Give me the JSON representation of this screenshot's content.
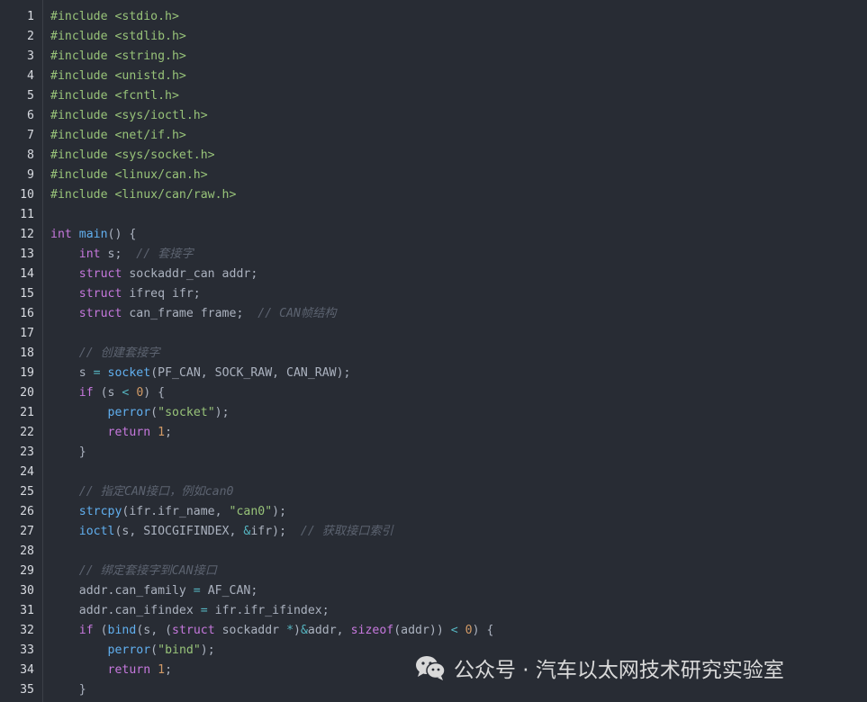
{
  "editor": {
    "lines": [
      {
        "n": "1",
        "tokens": [
          {
            "t": "#include ",
            "c": "pp"
          },
          {
            "t": "<stdio.h>",
            "c": "hdr"
          }
        ]
      },
      {
        "n": "2",
        "tokens": [
          {
            "t": "#include ",
            "c": "pp"
          },
          {
            "t": "<stdlib.h>",
            "c": "hdr"
          }
        ]
      },
      {
        "n": "3",
        "tokens": [
          {
            "t": "#include ",
            "c": "pp"
          },
          {
            "t": "<string.h>",
            "c": "hdr"
          }
        ]
      },
      {
        "n": "4",
        "tokens": [
          {
            "t": "#include ",
            "c": "pp"
          },
          {
            "t": "<unistd.h>",
            "c": "hdr"
          }
        ]
      },
      {
        "n": "5",
        "tokens": [
          {
            "t": "#include ",
            "c": "pp"
          },
          {
            "t": "<fcntl.h>",
            "c": "hdr"
          }
        ]
      },
      {
        "n": "6",
        "tokens": [
          {
            "t": "#include ",
            "c": "pp"
          },
          {
            "t": "<sys/ioctl.h>",
            "c": "hdr"
          }
        ]
      },
      {
        "n": "7",
        "tokens": [
          {
            "t": "#include ",
            "c": "pp"
          },
          {
            "t": "<net/if.h>",
            "c": "hdr"
          }
        ]
      },
      {
        "n": "8",
        "tokens": [
          {
            "t": "#include ",
            "c": "pp"
          },
          {
            "t": "<sys/socket.h>",
            "c": "hdr"
          }
        ]
      },
      {
        "n": "9",
        "tokens": [
          {
            "t": "#include ",
            "c": "pp"
          },
          {
            "t": "<linux/can.h>",
            "c": "hdr"
          }
        ]
      },
      {
        "n": "10",
        "tokens": [
          {
            "t": "#include ",
            "c": "pp"
          },
          {
            "t": "<linux/can/raw.h>",
            "c": "hdr"
          }
        ]
      },
      {
        "n": "11",
        "tokens": []
      },
      {
        "n": "12",
        "tokens": [
          {
            "t": "int",
            "c": "kw"
          },
          {
            "t": " ",
            "c": "plain"
          },
          {
            "t": "main",
            "c": "fn"
          },
          {
            "t": "() {",
            "c": "plain"
          }
        ]
      },
      {
        "n": "13",
        "tokens": [
          {
            "t": "    ",
            "c": "plain"
          },
          {
            "t": "int",
            "c": "kw"
          },
          {
            "t": " s;  ",
            "c": "plain"
          },
          {
            "t": "// 套接字",
            "c": "cmt"
          }
        ]
      },
      {
        "n": "14",
        "tokens": [
          {
            "t": "    ",
            "c": "plain"
          },
          {
            "t": "struct",
            "c": "kw"
          },
          {
            "t": " sockaddr_can addr;",
            "c": "plain"
          }
        ]
      },
      {
        "n": "15",
        "tokens": [
          {
            "t": "    ",
            "c": "plain"
          },
          {
            "t": "struct",
            "c": "kw"
          },
          {
            "t": " ifreq ifr;",
            "c": "plain"
          }
        ]
      },
      {
        "n": "16",
        "tokens": [
          {
            "t": "    ",
            "c": "plain"
          },
          {
            "t": "struct",
            "c": "kw"
          },
          {
            "t": " can_frame frame;  ",
            "c": "plain"
          },
          {
            "t": "// CAN帧结构",
            "c": "cmt"
          }
        ]
      },
      {
        "n": "17",
        "tokens": []
      },
      {
        "n": "18",
        "tokens": [
          {
            "t": "    ",
            "c": "plain"
          },
          {
            "t": "// 创建套接字",
            "c": "cmt"
          }
        ]
      },
      {
        "n": "19",
        "tokens": [
          {
            "t": "    s ",
            "c": "plain"
          },
          {
            "t": "=",
            "c": "op"
          },
          {
            "t": " ",
            "c": "plain"
          },
          {
            "t": "socket",
            "c": "fn"
          },
          {
            "t": "(PF_CAN, SOCK_RAW, CAN_RAW);",
            "c": "plain"
          }
        ]
      },
      {
        "n": "20",
        "tokens": [
          {
            "t": "    ",
            "c": "plain"
          },
          {
            "t": "if",
            "c": "kw"
          },
          {
            "t": " (s ",
            "c": "plain"
          },
          {
            "t": "<",
            "c": "op"
          },
          {
            "t": " ",
            "c": "plain"
          },
          {
            "t": "0",
            "c": "num"
          },
          {
            "t": ") {",
            "c": "plain"
          }
        ]
      },
      {
        "n": "21",
        "tokens": [
          {
            "t": "        ",
            "c": "plain"
          },
          {
            "t": "perror",
            "c": "fn"
          },
          {
            "t": "(",
            "c": "plain"
          },
          {
            "t": "\"socket\"",
            "c": "str"
          },
          {
            "t": ");",
            "c": "plain"
          }
        ]
      },
      {
        "n": "22",
        "tokens": [
          {
            "t": "        ",
            "c": "plain"
          },
          {
            "t": "return",
            "c": "kw"
          },
          {
            "t": " ",
            "c": "plain"
          },
          {
            "t": "1",
            "c": "num"
          },
          {
            "t": ";",
            "c": "plain"
          }
        ]
      },
      {
        "n": "23",
        "tokens": [
          {
            "t": "    }",
            "c": "plain"
          }
        ]
      },
      {
        "n": "24",
        "tokens": []
      },
      {
        "n": "25",
        "tokens": [
          {
            "t": "    ",
            "c": "plain"
          },
          {
            "t": "// 指定CAN接口，例如can0",
            "c": "cmt"
          }
        ]
      },
      {
        "n": "26",
        "tokens": [
          {
            "t": "    ",
            "c": "plain"
          },
          {
            "t": "strcpy",
            "c": "fn"
          },
          {
            "t": "(ifr.ifr_name, ",
            "c": "plain"
          },
          {
            "t": "\"can0\"",
            "c": "str"
          },
          {
            "t": ");",
            "c": "plain"
          }
        ]
      },
      {
        "n": "27",
        "tokens": [
          {
            "t": "    ",
            "c": "plain"
          },
          {
            "t": "ioctl",
            "c": "fn"
          },
          {
            "t": "(s, SIOCGIFINDEX, ",
            "c": "plain"
          },
          {
            "t": "&",
            "c": "op"
          },
          {
            "t": "ifr);  ",
            "c": "plain"
          },
          {
            "t": "// 获取接口索引",
            "c": "cmt"
          }
        ]
      },
      {
        "n": "28",
        "tokens": []
      },
      {
        "n": "29",
        "tokens": [
          {
            "t": "    ",
            "c": "plain"
          },
          {
            "t": "// 绑定套接字到CAN接口",
            "c": "cmt"
          }
        ]
      },
      {
        "n": "30",
        "tokens": [
          {
            "t": "    addr.can_family ",
            "c": "plain"
          },
          {
            "t": "=",
            "c": "op"
          },
          {
            "t": " AF_CAN;",
            "c": "plain"
          }
        ]
      },
      {
        "n": "31",
        "tokens": [
          {
            "t": "    addr.can_ifindex ",
            "c": "plain"
          },
          {
            "t": "=",
            "c": "op"
          },
          {
            "t": " ifr.ifr_ifindex;",
            "c": "plain"
          }
        ]
      },
      {
        "n": "32",
        "tokens": [
          {
            "t": "    ",
            "c": "plain"
          },
          {
            "t": "if",
            "c": "kw"
          },
          {
            "t": " (",
            "c": "plain"
          },
          {
            "t": "bind",
            "c": "fn"
          },
          {
            "t": "(s, (",
            "c": "plain"
          },
          {
            "t": "struct",
            "c": "kw"
          },
          {
            "t": " sockaddr ",
            "c": "plain"
          },
          {
            "t": "*",
            "c": "op"
          },
          {
            "t": ")",
            "c": "plain"
          },
          {
            "t": "&",
            "c": "op"
          },
          {
            "t": "addr, ",
            "c": "plain"
          },
          {
            "t": "sizeof",
            "c": "kw"
          },
          {
            "t": "(addr)) ",
            "c": "plain"
          },
          {
            "t": "<",
            "c": "op"
          },
          {
            "t": " ",
            "c": "plain"
          },
          {
            "t": "0",
            "c": "num"
          },
          {
            "t": ") {",
            "c": "plain"
          }
        ]
      },
      {
        "n": "33",
        "tokens": [
          {
            "t": "        ",
            "c": "plain"
          },
          {
            "t": "perror",
            "c": "fn"
          },
          {
            "t": "(",
            "c": "plain"
          },
          {
            "t": "\"bind\"",
            "c": "str"
          },
          {
            "t": ");",
            "c": "plain"
          }
        ]
      },
      {
        "n": "34",
        "tokens": [
          {
            "t": "        ",
            "c": "plain"
          },
          {
            "t": "return",
            "c": "kw"
          },
          {
            "t": " ",
            "c": "plain"
          },
          {
            "t": "1",
            "c": "num"
          },
          {
            "t": ";",
            "c": "plain"
          }
        ]
      },
      {
        "n": "35",
        "tokens": [
          {
            "t": "    }",
            "c": "plain"
          }
        ]
      }
    ]
  },
  "watermark": {
    "text": "公众号 · 汽车以太网技术研究实验室",
    "icon": "wechat-icon"
  },
  "colors": {
    "background": "#282c34",
    "keyword": "#c678dd",
    "function": "#61afef",
    "string": "#98c379",
    "number": "#d19a66",
    "comment": "#5c6370",
    "operator": "#56b6c2",
    "text": "#abb2bf"
  }
}
